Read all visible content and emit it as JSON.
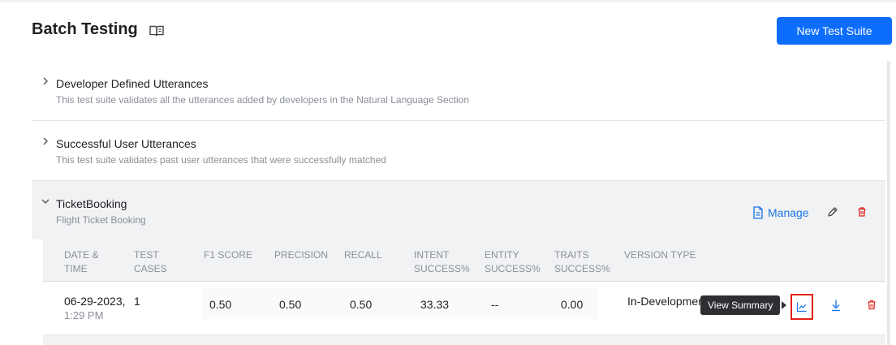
{
  "header": {
    "title": "Batch Testing",
    "new_button_label": "New Test Suite"
  },
  "suites": [
    {
      "name": "Developer Defined Utterances",
      "description": "This test suite validates all the utterances added by developers in the Natural Language Section",
      "expanded": false
    },
    {
      "name": "Successful User Utterances",
      "description": "This test suite validates past user utterances that were successfully matched",
      "expanded": false
    },
    {
      "name": "TicketBooking",
      "description": "Flight Ticket Booking",
      "expanded": true,
      "manage_label": "Manage"
    }
  ],
  "results": {
    "columns": {
      "date_l1": "DATE &",
      "date_l2": "TIME",
      "cases_l1": "TEST",
      "cases_l2": "CASES",
      "f1": "F1 SCORE",
      "precision": "PRECISION",
      "recall": "RECALL",
      "intent_l1": "INTENT",
      "intent_l2": "SUCCESS%",
      "entity_l1": "ENTITY",
      "entity_l2": "SUCCESS%",
      "traits_l1": "TRAITS",
      "traits_l2": "SUCCESS%",
      "version": "VERSION TYPE"
    },
    "rows": [
      {
        "date": "06-29-2023,",
        "time": "1:29 PM",
        "test_cases": "1",
        "f1_score": "0.50",
        "precision": "0.50",
        "recall": "0.50",
        "intent_success": "33.33",
        "entity_success": "--",
        "traits_success": "0.00",
        "version_type": "In-Development"
      }
    ]
  },
  "tooltip": "View Summary",
  "colors": {
    "primary": "#0d6efd",
    "link": "#1a73e8",
    "danger": "#e0201a",
    "highlight_box": "#e0201a"
  },
  "icons": [
    "book-icon",
    "chevron-right-icon",
    "chevron-down-icon",
    "document-icon",
    "pencil-icon",
    "trash-icon",
    "chart-icon",
    "download-icon"
  ]
}
